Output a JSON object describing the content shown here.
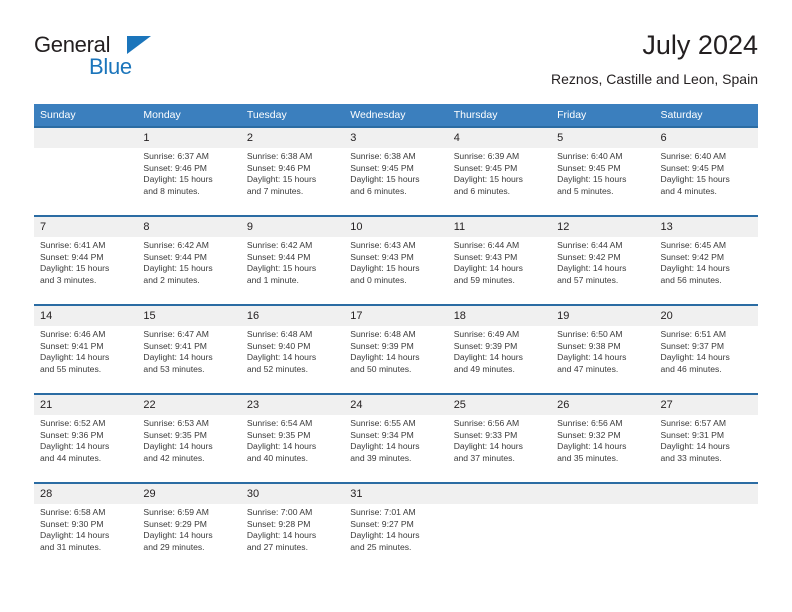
{
  "logo": {
    "general_text": "General",
    "blue_text": "Blue",
    "triangle_color": "#1b75bb"
  },
  "header": {
    "title": "July 2024",
    "subtitle": "Reznos, Castille and Leon, Spain"
  },
  "theme": {
    "header_bg": "#3b7fbe",
    "separator": "#2b6ca3",
    "daynum_bg": "#f0f0f0",
    "text": "#231f20"
  },
  "columns": [
    "Sunday",
    "Monday",
    "Tuesday",
    "Wednesday",
    "Thursday",
    "Friday",
    "Saturday"
  ],
  "weeks": [
    [
      {
        "day": "",
        "lines": []
      },
      {
        "day": "1",
        "lines": [
          "Sunrise: 6:37 AM",
          "Sunset: 9:46 PM",
          "Daylight: 15 hours",
          "and 8 minutes."
        ]
      },
      {
        "day": "2",
        "lines": [
          "Sunrise: 6:38 AM",
          "Sunset: 9:46 PM",
          "Daylight: 15 hours",
          "and 7 minutes."
        ]
      },
      {
        "day": "3",
        "lines": [
          "Sunrise: 6:38 AM",
          "Sunset: 9:45 PM",
          "Daylight: 15 hours",
          "and 6 minutes."
        ]
      },
      {
        "day": "4",
        "lines": [
          "Sunrise: 6:39 AM",
          "Sunset: 9:45 PM",
          "Daylight: 15 hours",
          "and 6 minutes."
        ]
      },
      {
        "day": "5",
        "lines": [
          "Sunrise: 6:40 AM",
          "Sunset: 9:45 PM",
          "Daylight: 15 hours",
          "and 5 minutes."
        ]
      },
      {
        "day": "6",
        "lines": [
          "Sunrise: 6:40 AM",
          "Sunset: 9:45 PM",
          "Daylight: 15 hours",
          "and 4 minutes."
        ]
      }
    ],
    [
      {
        "day": "7",
        "lines": [
          "Sunrise: 6:41 AM",
          "Sunset: 9:44 PM",
          "Daylight: 15 hours",
          "and 3 minutes."
        ]
      },
      {
        "day": "8",
        "lines": [
          "Sunrise: 6:42 AM",
          "Sunset: 9:44 PM",
          "Daylight: 15 hours",
          "and 2 minutes."
        ]
      },
      {
        "day": "9",
        "lines": [
          "Sunrise: 6:42 AM",
          "Sunset: 9:44 PM",
          "Daylight: 15 hours",
          "and 1 minute."
        ]
      },
      {
        "day": "10",
        "lines": [
          "Sunrise: 6:43 AM",
          "Sunset: 9:43 PM",
          "Daylight: 15 hours",
          "and 0 minutes."
        ]
      },
      {
        "day": "11",
        "lines": [
          "Sunrise: 6:44 AM",
          "Sunset: 9:43 PM",
          "Daylight: 14 hours",
          "and 59 minutes."
        ]
      },
      {
        "day": "12",
        "lines": [
          "Sunrise: 6:44 AM",
          "Sunset: 9:42 PM",
          "Daylight: 14 hours",
          "and 57 minutes."
        ]
      },
      {
        "day": "13",
        "lines": [
          "Sunrise: 6:45 AM",
          "Sunset: 9:42 PM",
          "Daylight: 14 hours",
          "and 56 minutes."
        ]
      }
    ],
    [
      {
        "day": "14",
        "lines": [
          "Sunrise: 6:46 AM",
          "Sunset: 9:41 PM",
          "Daylight: 14 hours",
          "and 55 minutes."
        ]
      },
      {
        "day": "15",
        "lines": [
          "Sunrise: 6:47 AM",
          "Sunset: 9:41 PM",
          "Daylight: 14 hours",
          "and 53 minutes."
        ]
      },
      {
        "day": "16",
        "lines": [
          "Sunrise: 6:48 AM",
          "Sunset: 9:40 PM",
          "Daylight: 14 hours",
          "and 52 minutes."
        ]
      },
      {
        "day": "17",
        "lines": [
          "Sunrise: 6:48 AM",
          "Sunset: 9:39 PM",
          "Daylight: 14 hours",
          "and 50 minutes."
        ]
      },
      {
        "day": "18",
        "lines": [
          "Sunrise: 6:49 AM",
          "Sunset: 9:39 PM",
          "Daylight: 14 hours",
          "and 49 minutes."
        ]
      },
      {
        "day": "19",
        "lines": [
          "Sunrise: 6:50 AM",
          "Sunset: 9:38 PM",
          "Daylight: 14 hours",
          "and 47 minutes."
        ]
      },
      {
        "day": "20",
        "lines": [
          "Sunrise: 6:51 AM",
          "Sunset: 9:37 PM",
          "Daylight: 14 hours",
          "and 46 minutes."
        ]
      }
    ],
    [
      {
        "day": "21",
        "lines": [
          "Sunrise: 6:52 AM",
          "Sunset: 9:36 PM",
          "Daylight: 14 hours",
          "and 44 minutes."
        ]
      },
      {
        "day": "22",
        "lines": [
          "Sunrise: 6:53 AM",
          "Sunset: 9:35 PM",
          "Daylight: 14 hours",
          "and 42 minutes."
        ]
      },
      {
        "day": "23",
        "lines": [
          "Sunrise: 6:54 AM",
          "Sunset: 9:35 PM",
          "Daylight: 14 hours",
          "and 40 minutes."
        ]
      },
      {
        "day": "24",
        "lines": [
          "Sunrise: 6:55 AM",
          "Sunset: 9:34 PM",
          "Daylight: 14 hours",
          "and 39 minutes."
        ]
      },
      {
        "day": "25",
        "lines": [
          "Sunrise: 6:56 AM",
          "Sunset: 9:33 PM",
          "Daylight: 14 hours",
          "and 37 minutes."
        ]
      },
      {
        "day": "26",
        "lines": [
          "Sunrise: 6:56 AM",
          "Sunset: 9:32 PM",
          "Daylight: 14 hours",
          "and 35 minutes."
        ]
      },
      {
        "day": "27",
        "lines": [
          "Sunrise: 6:57 AM",
          "Sunset: 9:31 PM",
          "Daylight: 14 hours",
          "and 33 minutes."
        ]
      }
    ],
    [
      {
        "day": "28",
        "lines": [
          "Sunrise: 6:58 AM",
          "Sunset: 9:30 PM",
          "Daylight: 14 hours",
          "and 31 minutes."
        ]
      },
      {
        "day": "29",
        "lines": [
          "Sunrise: 6:59 AM",
          "Sunset: 9:29 PM",
          "Daylight: 14 hours",
          "and 29 minutes."
        ]
      },
      {
        "day": "30",
        "lines": [
          "Sunrise: 7:00 AM",
          "Sunset: 9:28 PM",
          "Daylight: 14 hours",
          "and 27 minutes."
        ]
      },
      {
        "day": "31",
        "lines": [
          "Sunrise: 7:01 AM",
          "Sunset: 9:27 PM",
          "Daylight: 14 hours",
          "and 25 minutes."
        ]
      },
      {
        "day": "",
        "lines": []
      },
      {
        "day": "",
        "lines": []
      },
      {
        "day": "",
        "lines": []
      }
    ]
  ]
}
